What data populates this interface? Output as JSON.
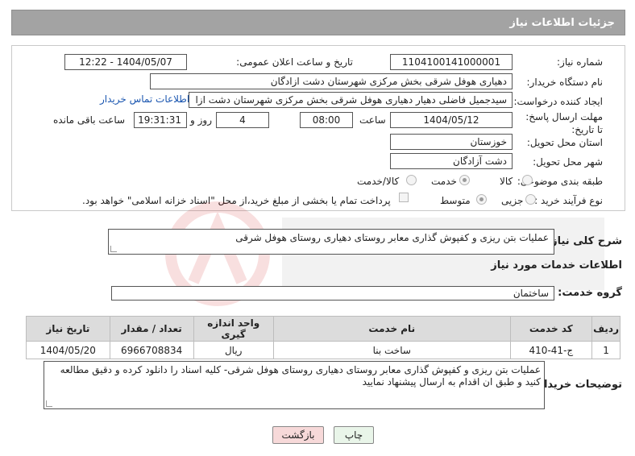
{
  "header": {
    "title": "جزئیات اطلاعات نیاز"
  },
  "fields": {
    "need_number_label": "شماره نیاز:",
    "need_number": "1104100141000001",
    "announce_label": "تاریخ و ساعت اعلان عمومی:",
    "announce_value": "1404/05/07 - 12:22",
    "buyer_org_label": "نام دستگاه خریدار:",
    "buyer_org": "دهیاری هوفل شرقی بخش مرکزی شهرستان دشت ازادگان",
    "requester_label": "ایجاد کننده درخواست:",
    "requester": "سیدجمیل فاضلی دهیار دهیاری هوفل شرقی بخش مرکزی شهرستان دشت ازا",
    "contact_link": "اطلاعات تماس خریدار",
    "deadline_label": "مهلت ارسال پاسخ: تا تاریخ:",
    "deadline_date": "1404/05/12",
    "time_label": "ساعت",
    "deadline_time": "08:00",
    "days_value": "4",
    "days_label": "روز و",
    "remaining_time": "19:31:31",
    "remaining_label": "ساعت باقی مانده",
    "province_label": "استان محل تحویل:",
    "province": "خوزستان",
    "city_label": "شهر محل تحویل:",
    "city": "دشت آزادگان",
    "category_label": "طبقه بندی موضوعی:",
    "category_options": [
      "کالا",
      "خدمت",
      "کالا/خدمت"
    ],
    "purchase_type_label": "نوع فرآیند خرید :",
    "purchase_options": [
      "جزیی",
      "متوسط"
    ],
    "payment_note": "پرداخت تمام یا بخشی از مبلغ خرید،از محل \"اسناد خزانه اسلامی\" خواهد بود."
  },
  "summary": {
    "label": "شرح کلی نیاز:",
    "text": "عملیات بتن ریزی و کفپوش گذاری معابر روستای دهیاری روستای هوفل شرقی"
  },
  "services": {
    "section_title": "اطلاعات خدمات مورد نیاز",
    "group_label": "گروه خدمت:",
    "group_value": "ساختمان",
    "columns": [
      "ردیف",
      "کد خدمت",
      "نام خدمت",
      "واحد اندازه گیری",
      "تعداد / مقدار",
      "تاریخ نیاز"
    ],
    "rows": [
      [
        "1",
        "ج-41-410",
        "ساخت بنا",
        "ریال",
        "6966708834",
        "1404/05/20"
      ]
    ]
  },
  "buyer_notes": {
    "label": "توضیحات خریدار:",
    "text": "عملیات بتن ریزی و کفپوش گذاری معابر روستای دهیاری روستای هوفل شرقی- کلیه اسناد را دانلود کرده و دقیق مطالعه کنید و طبق ان اقدام به ارسال پیشنهاد نمایید"
  },
  "buttons": {
    "print": "چاپ",
    "back": "بازگشت"
  },
  "colors": {
    "title_bg": "#a3a3a3",
    "link": "#1a56b0",
    "back_btn_bg": "#f7d9d9",
    "print_btn_bg": "#e9f5e9"
  }
}
